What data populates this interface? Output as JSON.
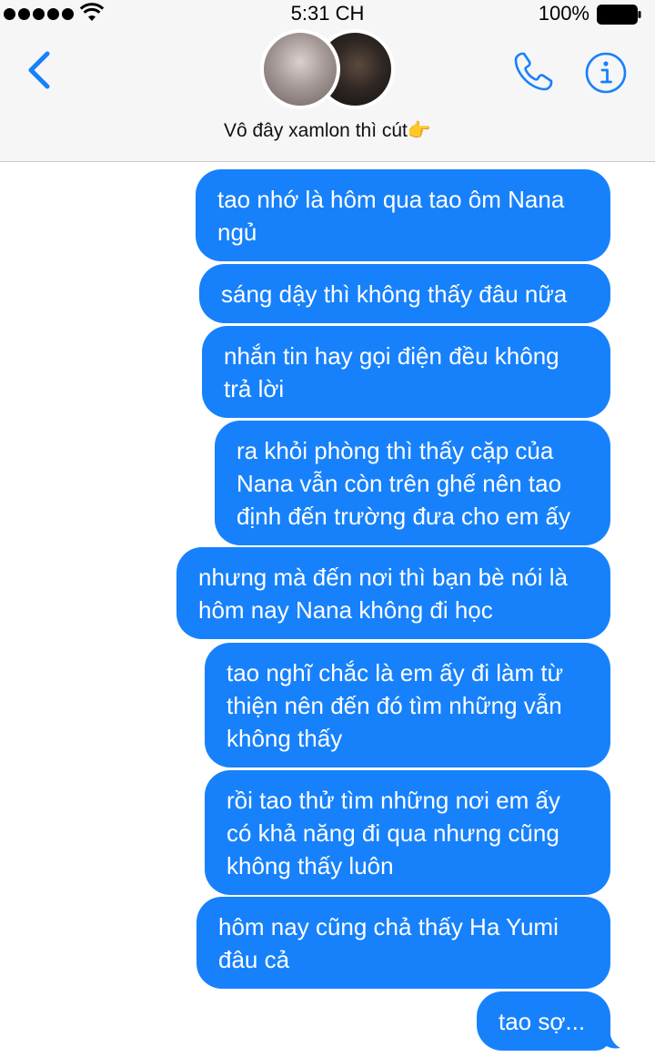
{
  "status_bar": {
    "time": "5:31 CH",
    "battery": "100%"
  },
  "conversation": {
    "name": "Vô đây xamlon thì cút👉"
  },
  "colors": {
    "accent": "#1781fb",
    "header_bg": "#f6f6f7"
  },
  "icons": [
    "back-chevron-icon",
    "phone-icon",
    "info-icon",
    "wifi-icon",
    "battery-icon"
  ],
  "messages": [
    {
      "text": "tao nhớ là hôm qua tao ôm Nana ngủ"
    },
    {
      "text": "sáng dậy thì không thấy đâu nữa"
    },
    {
      "text": "nhắn tin hay gọi điện đều không trả lời"
    },
    {
      "text": "ra khỏi phòng thì thấy cặp của Nana vẫn còn trên ghế nên tao định đến trường đưa cho em ấy"
    },
    {
      "text": "nhưng mà đến nơi thì bạn bè nói là hôm nay Nana không đi học"
    },
    {
      "text": "tao nghĩ chắc là em ấy đi làm từ thiện nên đến đó tìm những vẫn không thấy"
    },
    {
      "text": "rồi tao thử tìm những nơi em ấy có khả năng đi qua nhưng cũng không thấy luôn"
    },
    {
      "text": "hôm nay cũng chả thấy Ha Yumi đâu cả"
    },
    {
      "text": "tao sợ..."
    }
  ]
}
